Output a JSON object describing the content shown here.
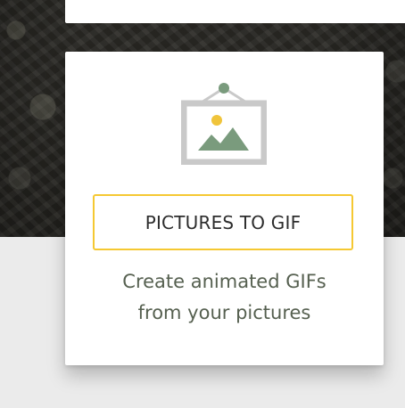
{
  "feature": {
    "icon": "framed-picture-icon",
    "button_label": "PICTURES TO GIF",
    "description_line1": "Create animated GIFs",
    "description_line2": "from your pictures"
  },
  "colors": {
    "accent_border": "#f5c832",
    "icon_frame": "#c9c9c9",
    "icon_mountain": "#7a9b7d",
    "icon_sun": "#f0c43b",
    "description_text": "#566050",
    "button_text": "#2d2d2d"
  }
}
